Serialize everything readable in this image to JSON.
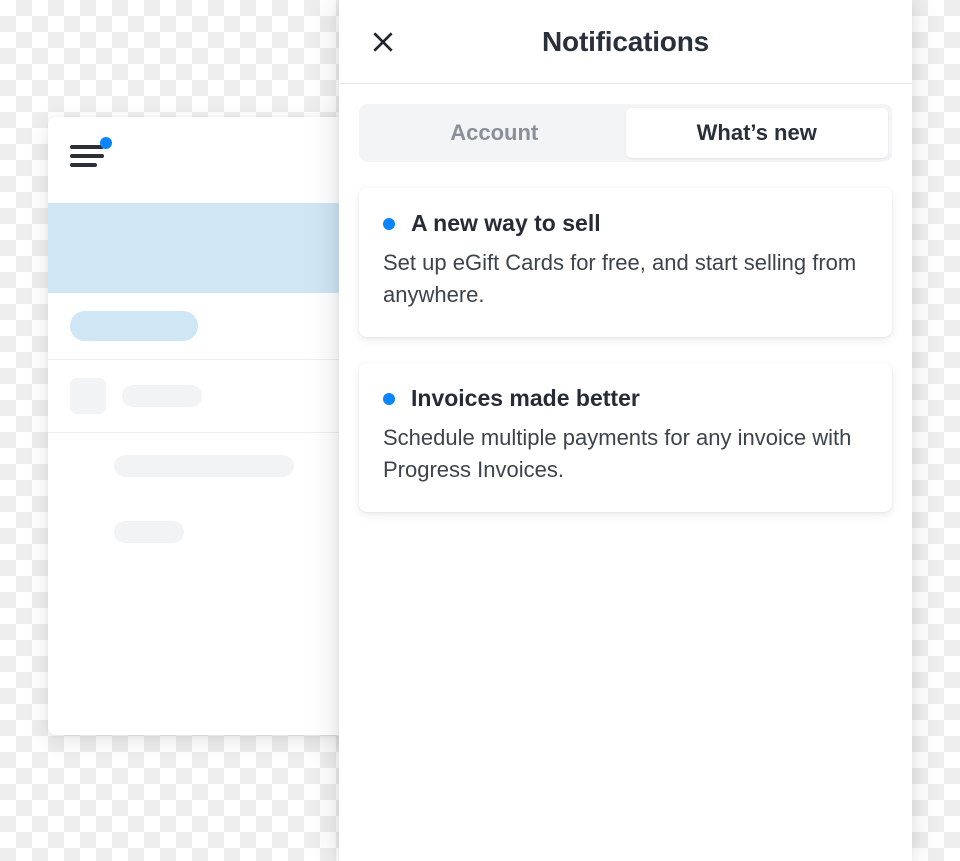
{
  "panel": {
    "title": "Notifications",
    "tabs": {
      "account": "Account",
      "whats_new": "What’s new"
    },
    "items": [
      {
        "title": "A new way to sell",
        "body": "Set up eGift Cards for free, and start selling from anywhere."
      },
      {
        "title": "Invoices made better",
        "body": "Schedule multiple payments for any invoice with Progress Invoices."
      }
    ]
  },
  "colors": {
    "accent": "#0a84ff"
  }
}
